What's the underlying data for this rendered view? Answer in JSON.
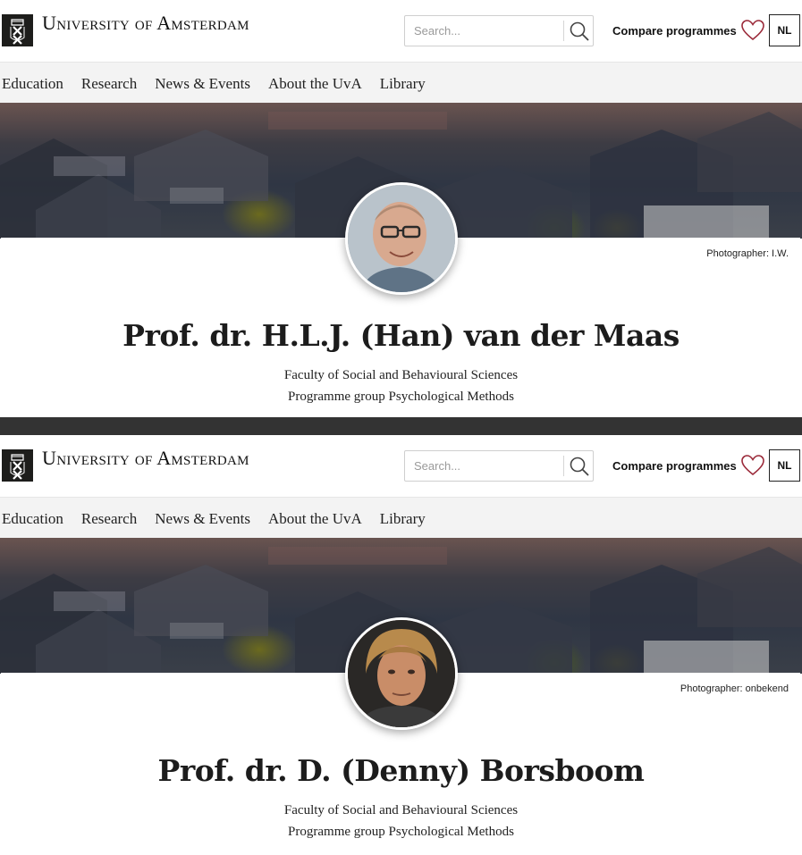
{
  "profiles": [
    {
      "brand": "University of Amsterdam",
      "search_placeholder": "Search...",
      "compare_label": "Compare programmes",
      "language": "NL",
      "nav": [
        "Education",
        "Research",
        "News & Events",
        "About the UvA",
        "Library"
      ],
      "photographer": "Photographer: I.W.",
      "name": "Prof. dr. H.L.J. (Han) van der Maas",
      "faculty": "Faculty of Social and Behavioural Sciences",
      "programme_group": "Programme group Psychological Methods"
    },
    {
      "brand": "University of Amsterdam",
      "search_placeholder": "Search...",
      "compare_label": "Compare programmes",
      "language": "NL",
      "nav": [
        "Education",
        "Research",
        "News & Events",
        "About the UvA",
        "Library"
      ],
      "photographer": "Photographer: onbekend",
      "name": "Prof. dr. D. (Denny) Borsboom",
      "faculty": "Faculty of Social and Behavioural Sciences",
      "programme_group": "Programme group Psychological Methods"
    }
  ],
  "colors": {
    "heart": "#9b2a3a",
    "divider": "#333333",
    "nav_bg": "#f3f3f3"
  }
}
